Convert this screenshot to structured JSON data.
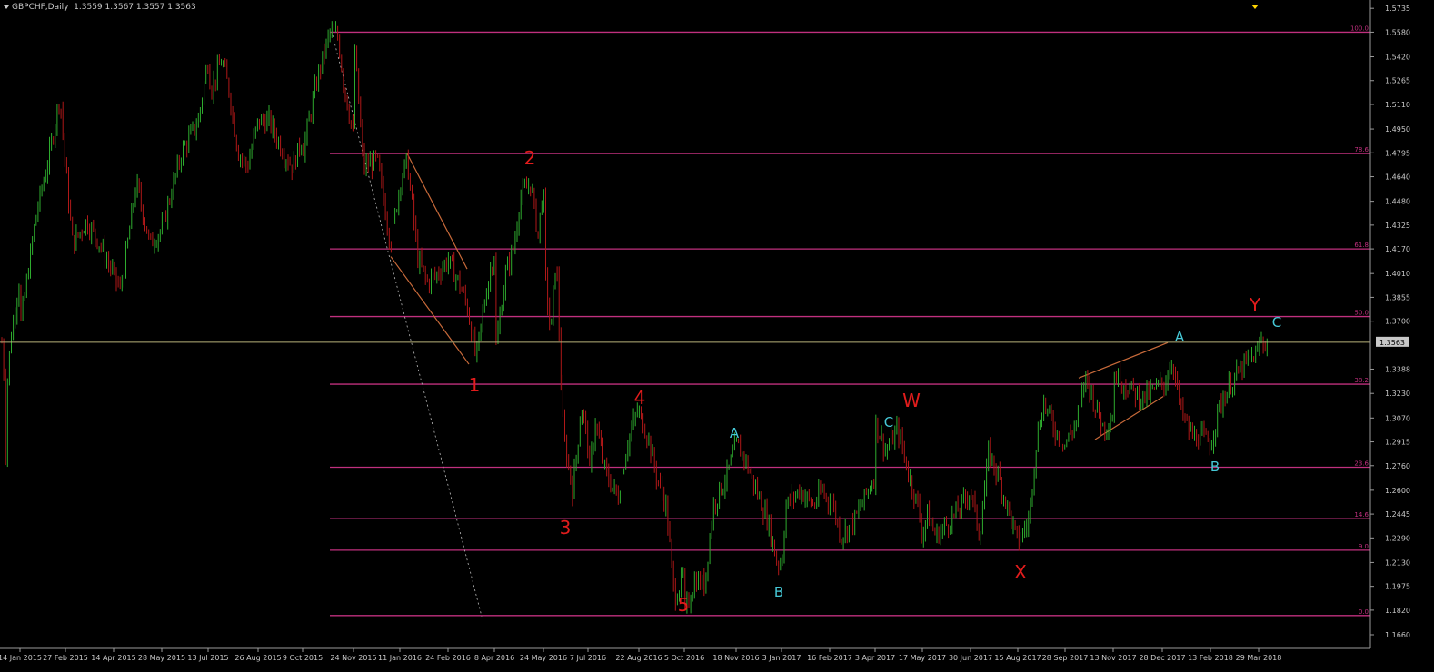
{
  "header": {
    "symbol": "GBPCHF,Daily",
    "ohlc": "1.3559 1.3567 1.3557 1.3563"
  },
  "colors": {
    "background": "#000000",
    "bull": "#2eab2e",
    "bear": "#b01818",
    "fib": "#c0307e",
    "wave_red": "#e11c1c",
    "wave_cyan": "#46c8d6",
    "price_line": "#b8b27a",
    "trendline": "#c86a3a"
  },
  "chart_data": {
    "type": "candlestick",
    "title": "GBPCHF,Daily",
    "x_tick_labels": [
      "14 Jan 2015",
      "27 Feb 2015",
      "14 Apr 2015",
      "28 May 2015",
      "13 Jul 2015",
      "26 Aug 2015",
      "9 Oct 2015",
      "24 Nov 2015",
      "11 Jan 2016",
      "24 Feb 2016",
      "8 Apr 2016",
      "24 May 2016",
      "7 Jul 2016",
      "22 Aug 2016",
      "5 Oct 2016",
      "18 Nov 2016",
      "3 Jan 2017",
      "16 Feb 2017",
      "3 Apr 2017",
      "17 May 2017",
      "30 Jun 2017",
      "15 Aug 2017",
      "28 Sep 2017",
      "13 Nov 2017",
      "28 Dec 2017",
      "13 Feb 2018",
      "29 Mar 2018"
    ],
    "y_ticks": [
      1.5735,
      1.558,
      1.542,
      1.5265,
      1.511,
      1.495,
      1.4795,
      1.464,
      1.448,
      1.4325,
      1.417,
      1.401,
      1.3855,
      1.37,
      1.3388,
      1.323,
      1.307,
      1.2915,
      1.276,
      1.26,
      1.2445,
      1.229,
      1.213,
      1.1975,
      1.182,
      1.166
    ],
    "ylim": [
      1.164,
      1.577
    ],
    "current_price": 1.3563,
    "approx_closes": [
      [
        "14 Jan 2015",
        1.365
      ],
      [
        "20 Jan 2015",
        1.33
      ],
      [
        "27 Feb 2015",
        1.47
      ],
      [
        "14 Apr 2015",
        1.4
      ],
      [
        "28 May 2015",
        1.43
      ],
      [
        "13 Jul 2015",
        1.54
      ],
      [
        "26 Aug 2015",
        1.5
      ],
      [
        "9 Oct 2015",
        1.48
      ],
      [
        "24 Nov 2015",
        1.558
      ],
      [
        "11 Jan 2016",
        1.46
      ],
      [
        "24 Feb 2016",
        1.41
      ],
      [
        "8 Apr 2016",
        1.345
      ],
      [
        "24 May 2016",
        1.46
      ],
      [
        "23 Jun 2016",
        1.35
      ],
      [
        "7 Jul 2016",
        1.26
      ],
      [
        "22 Aug 2016",
        1.31
      ],
      [
        "5 Oct 2016",
        1.179
      ],
      [
        "18 Nov 2016",
        1.29
      ],
      [
        "3 Jan 2017",
        1.213
      ],
      [
        "16 Feb 2017",
        1.26
      ],
      [
        "3 Apr 2017",
        1.305
      ],
      [
        "17 May 2017",
        1.23
      ],
      [
        "30 Jun 2017",
        1.26
      ],
      [
        "15 Aug 2017",
        1.226
      ],
      [
        "28 Sep 2017",
        1.29
      ],
      [
        "13 Nov 2017",
        1.335
      ],
      [
        "28 Dec 2017",
        1.325
      ],
      [
        "13 Feb 2018",
        1.29
      ],
      [
        "29 Mar 2018",
        1.3563
      ]
    ],
    "fib_levels": [
      {
        "label": "100.0",
        "price": 1.558
      },
      {
        "label": "78.6",
        "price": 1.479
      },
      {
        "label": "61.8",
        "price": 1.417
      },
      {
        "label": "50.0",
        "price": 1.373
      },
      {
        "label": "38.2",
        "price": 1.329
      },
      {
        "label": "23.6",
        "price": 1.275
      },
      {
        "label": "14.6",
        "price": 1.2415
      },
      {
        "label": "9.0",
        "price": 1.221
      },
      {
        "label": "0.0",
        "price": 1.1785
      }
    ],
    "wave_labels": [
      {
        "text": "1",
        "color": "red"
      },
      {
        "text": "2",
        "color": "red"
      },
      {
        "text": "3",
        "color": "red"
      },
      {
        "text": "4",
        "color": "red"
      },
      {
        "text": "5",
        "color": "red"
      },
      {
        "text": "W",
        "color": "red"
      },
      {
        "text": "X",
        "color": "red"
      },
      {
        "text": "Y",
        "color": "red"
      },
      {
        "text": "A",
        "color": "cyan"
      },
      {
        "text": "B",
        "color": "cyan"
      },
      {
        "text": "C",
        "color": "cyan"
      },
      {
        "text": "A",
        "color": "cyan"
      },
      {
        "text": "B",
        "color": "cyan"
      },
      {
        "text": "C",
        "color": "cyan"
      }
    ],
    "grid": false
  }
}
